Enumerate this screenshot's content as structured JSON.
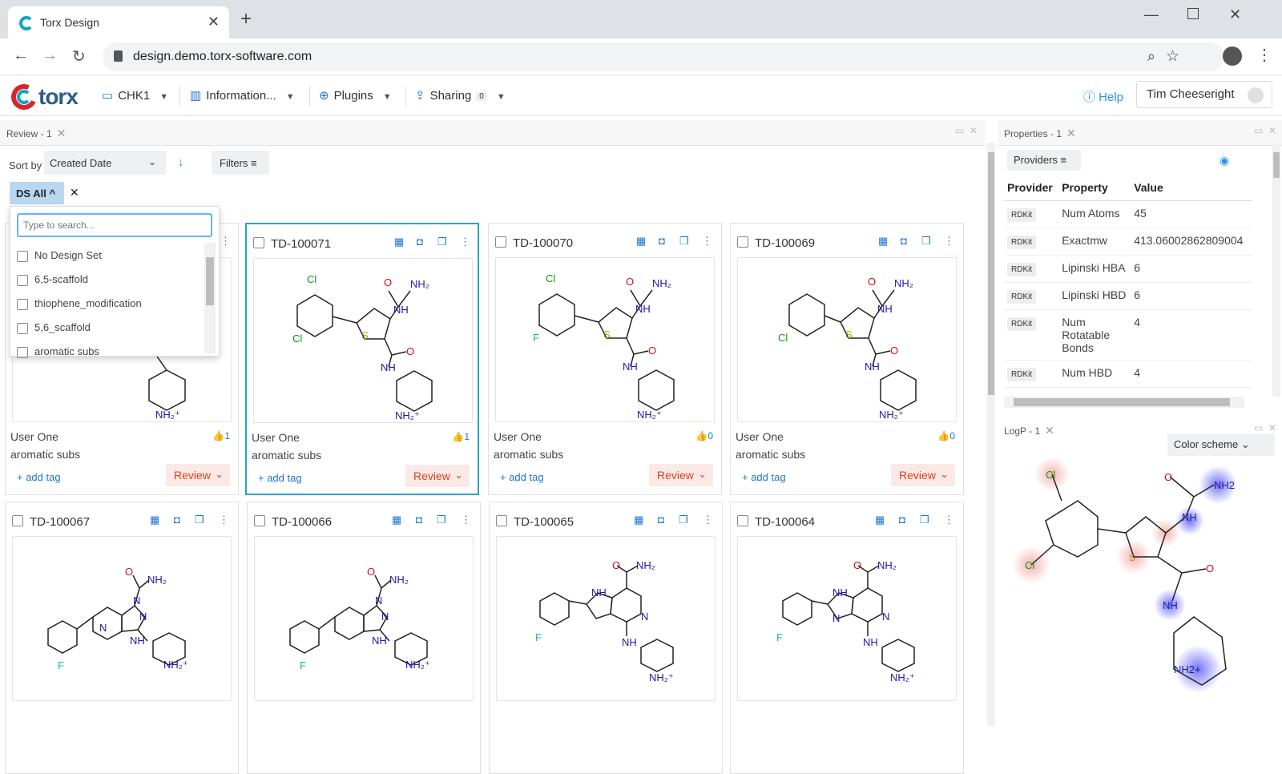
{
  "browser": {
    "tab_title": "Torx Design",
    "url": "design.demo.torx-software.com"
  },
  "app": {
    "brand": "torx",
    "menu": {
      "project": "CHK1",
      "information": "Information...",
      "plugins": "Plugins",
      "sharing": "Sharing",
      "sharing_count": "0"
    },
    "help": "Help",
    "user": "Tim Cheeseright"
  },
  "review": {
    "tab_label": "Review - 1",
    "sort_label": "Sort by",
    "sort_value": "Created Date",
    "filters_label": "Filters",
    "chip_label": "DS All",
    "dropdown": {
      "search_placeholder": "Type to search...",
      "items": [
        "No Design Set",
        "6,5-scaffold",
        "thiophene_modification",
        "5,6_scaffold",
        "aromatic subs"
      ]
    },
    "cards": [
      {
        "id": "",
        "user": "User One",
        "design_set": "aromatic subs",
        "likes": "1",
        "add_tag": "+ add tag",
        "review": "Review"
      },
      {
        "id": "TD-100071",
        "user": "User One",
        "design_set": "aromatic subs",
        "likes": "1",
        "add_tag": "+ add tag",
        "review": "Review"
      },
      {
        "id": "TD-100070",
        "user": "User One",
        "design_set": "aromatic subs",
        "likes": "0",
        "add_tag": "+ add tag",
        "review": "Review"
      },
      {
        "id": "TD-100069",
        "user": "User One",
        "design_set": "aromatic subs",
        "likes": "0",
        "add_tag": "+ add tag",
        "review": "Review"
      },
      {
        "id": "TD-100067"
      },
      {
        "id": "TD-100066"
      },
      {
        "id": "TD-100065"
      },
      {
        "id": "TD-100064"
      }
    ]
  },
  "properties": {
    "tab_label": "Properties - 1",
    "providers_label": "Providers",
    "headers": [
      "Provider",
      "Property",
      "Value"
    ],
    "rows": [
      {
        "provider": "RDKit",
        "property": "Num Atoms",
        "value": "45"
      },
      {
        "provider": "RDKit",
        "property": "Exactmw",
        "value": "413.06002862809004"
      },
      {
        "provider": "RDKit",
        "property": "Lipinski HBA",
        "value": "6"
      },
      {
        "provider": "RDKit",
        "property": "Lipinski HBD",
        "value": "6"
      },
      {
        "provider": "RDKit",
        "property": "Num Rotatable Bonds",
        "value": "4"
      },
      {
        "provider": "RDKit",
        "property": "Num HBD",
        "value": "4"
      }
    ]
  },
  "logp": {
    "tab_label": "LogP - 1",
    "color_scheme_label": "Color scheme"
  }
}
